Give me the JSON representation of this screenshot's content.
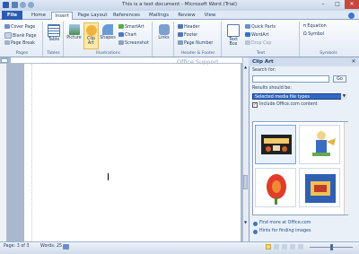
{
  "window": {
    "title": "This is a test document - Microsoft Word (Trial)"
  },
  "tabs": [
    "File",
    "Home",
    "Insert",
    "Page Layout",
    "References",
    "Mailings",
    "Review",
    "View"
  ],
  "ribbon": {
    "pages": {
      "label": "Pages",
      "cover_page": "Cover Page",
      "blank_page": "Blank Page",
      "page_break": "Page Break"
    },
    "tables": {
      "label": "Tables",
      "table": "Table"
    },
    "illustrations": {
      "label": "Illustrations",
      "picture": "Picture",
      "clip_art": "Clip Art",
      "shapes": "Shapes",
      "smartart": "SmartArt",
      "chart": "Chart",
      "screenshot": "Screenshot"
    },
    "links": {
      "label": "",
      "links": "Links"
    },
    "header_footer": {
      "label": "Header & Footer",
      "header": "Header",
      "footer": "Footer",
      "page_number": "Page Number"
    },
    "text": {
      "label": "Text",
      "text_box": "Text Box",
      "quick_parts": "Quick Parts",
      "wordart": "WordArt",
      "drop_cap": "Drop Cap"
    },
    "symbols": {
      "label": "Symbols",
      "equation": "Equation",
      "symbol": "Symbol"
    }
  },
  "document": {
    "ghost_text": "Office Support"
  },
  "clip_art_pane": {
    "title": "Clip Art",
    "search_label": "Search for:",
    "search_value": "",
    "go_label": "Go",
    "results_label": "Results should be:",
    "results_value": "Selected media file types",
    "include_label": "Include Office.com content",
    "include_checked": true,
    "find_more": "Find more at Office.com",
    "hints": "Hints for finding images"
  },
  "status": {
    "page": "Page: 3 of 3",
    "words": "Words: 25"
  },
  "colors": {
    "accent": "#2a5cb0",
    "ribbon_bg": "#e3ebf5",
    "selection": "#316ac5"
  }
}
